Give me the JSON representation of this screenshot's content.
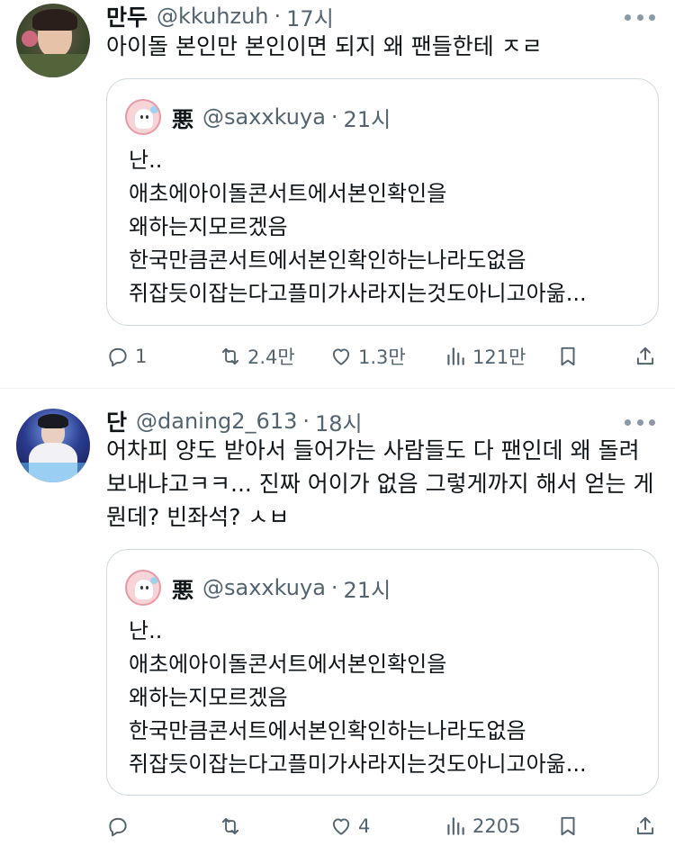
{
  "tweets": [
    {
      "name": "만두",
      "handle": "@kkuhzuh",
      "time": "17시",
      "text": "아이돌 본인만 본인이면 되지 왜 팬들한테 ㅈㄹ",
      "quote": {
        "name": "悪",
        "handle": "@saxxkuya",
        "time": "21시",
        "lines": [
          "난..",
          "애초에아이돌콘서트에서본인확인을",
          "왜하는지모르겠음",
          "한국만큼콘서트에서본인확인하는나라도없음",
          "쥐잡듯이잡는다고플미가사라지는것도아니고아욺..."
        ]
      },
      "actions": {
        "reply": "1",
        "retweet": "2.4만",
        "like": "1.3만",
        "views": "121만"
      }
    },
    {
      "name": "단",
      "handle": "@daning2_613",
      "time": "18시",
      "text": "어차피 양도 받아서 들어가는 사람들도 다 팬인데 왜 돌려보내냐고ㅋㅋ... 진짜 어이가 없음 그렇게까지 해서 얻는 게 뭔데? 빈좌석? ㅅㅂ",
      "quote": {
        "name": "悪",
        "handle": "@saxxkuya",
        "time": "21시",
        "lines": [
          "난..",
          "애초에아이돌콘서트에서본인확인을",
          "왜하는지모르겠음",
          "한국만큼콘서트에서본인확인하는나라도없음",
          "쥐잡듯이잡는다고플미가사라지는것도아니고아욺..."
        ]
      },
      "actions": {
        "reply": "",
        "retweet": "",
        "like": "4",
        "views": "2205"
      }
    }
  ],
  "colors": {
    "text": "#0f1419",
    "secondary": "#536471",
    "border": "#cfd9de",
    "divider": "#eff3f4"
  },
  "icons": [
    "reply-icon",
    "retweet-icon",
    "like-icon",
    "views-icon",
    "bookmark-icon",
    "share-icon",
    "more-icon"
  ]
}
